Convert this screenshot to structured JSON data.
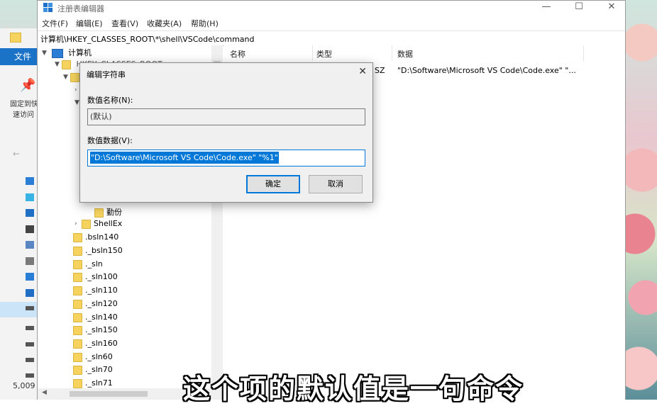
{
  "explorer": {
    "file_tab": "文件",
    "pin_label_1": "固定到快",
    "pin_label_2": "速访问",
    "status_count": "5,009"
  },
  "window": {
    "title": "注册表编辑器",
    "minimize": "—",
    "maximize": "☐",
    "close": "✕"
  },
  "menu": [
    "文件(F)",
    "编辑(E)",
    "查看(V)",
    "收藏夹(A)",
    "帮助(H)"
  ],
  "address": "计算机\\HKEY_CLASSES_ROOT\\*\\shell\\VSCode\\command",
  "tree": {
    "root": "计算机",
    "partial_key": "HKEY_CLASSES_ROOT",
    "item_backup": "勤份",
    "item_shellex": "ShellEx",
    "items": [
      ".bsln140",
      "._bsln150",
      "._sln",
      "._sln100",
      "._sln110",
      "._sln120",
      "._sln140",
      "._sln150",
      "._sln160",
      "._sln60",
      "._sln70",
      "._sln71"
    ]
  },
  "list": {
    "columns": [
      "名称",
      "类型",
      "数据"
    ],
    "row": {
      "type_partial": "SZ",
      "data": "\"D:\\Software\\Microsoft VS Code\\Code.exe\" \"..."
    }
  },
  "dialog": {
    "title": "编辑字符串",
    "close": "✕",
    "name_label": "数值名称(N):",
    "name_value": "(默认)",
    "data_label": "数值数据(V):",
    "data_value": "\"D:\\Software\\Microsoft VS Code\\Code.exe\" \"%1\"",
    "ok": "确定",
    "cancel": "取消"
  },
  "caption": "这个项的默认值是一句命令"
}
